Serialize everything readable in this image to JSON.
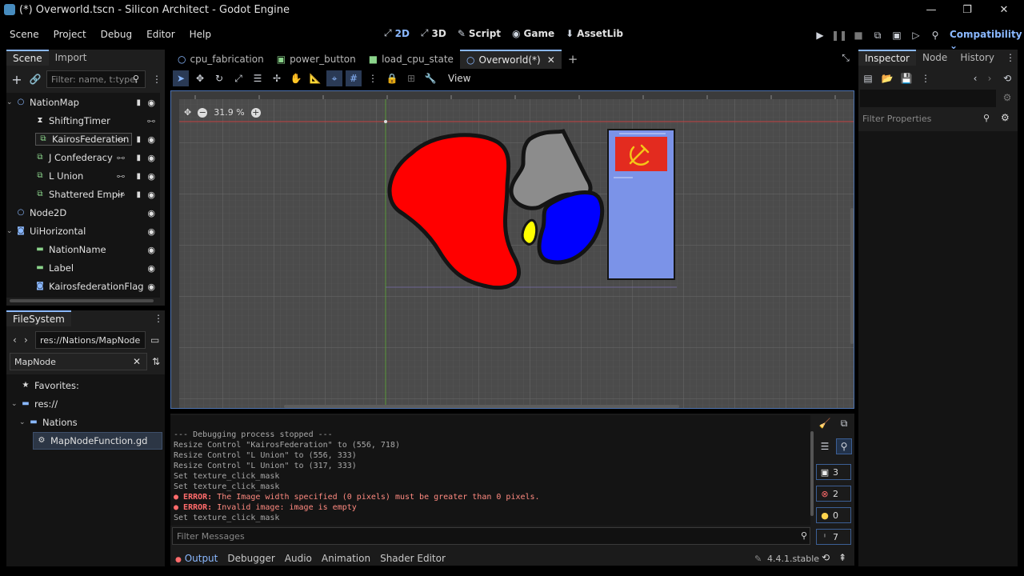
{
  "window": {
    "title": "(*) Overworld.tscn - Silicon Architect - Godot Engine"
  },
  "menu": [
    "Scene",
    "Project",
    "Debug",
    "Editor",
    "Help"
  ],
  "workspaces": [
    {
      "icon": "2d-icon",
      "glyph": "⬈",
      "label": "2D",
      "active": true
    },
    {
      "icon": "3d-icon",
      "glyph": "⬈",
      "label": "3D"
    },
    {
      "icon": "script-icon",
      "glyph": "✎",
      "label": "Script"
    },
    {
      "icon": "game-icon",
      "glyph": "🎮",
      "label": "Game"
    },
    {
      "icon": "assetlib-icon",
      "glyph": "⬇",
      "label": "AssetLib"
    }
  ],
  "renderer": "Compatibility",
  "scene_dock": {
    "tabs": [
      "Scene",
      "Import"
    ],
    "filter_placeholder": "Filter: name, t:type, g:",
    "tree": [
      {
        "label": "NationMap",
        "indent": 0,
        "expanded": true
      },
      {
        "label": "ShiftingTimer",
        "indent": 1
      },
      {
        "label": "KairosFederation",
        "indent": 1,
        "selected": true
      },
      {
        "label": "J Confederacy",
        "indent": 1
      },
      {
        "label": "L Union",
        "indent": 1
      },
      {
        "label": "Shattered Empir",
        "indent": 1
      },
      {
        "label": "Node2D",
        "indent": 0
      },
      {
        "label": "UiHorizontal",
        "indent": 0,
        "expanded": true
      },
      {
        "label": "NationName",
        "indent": 1
      },
      {
        "label": "Label",
        "indent": 1
      },
      {
        "label": "KairosfederationFlag",
        "indent": 1
      }
    ]
  },
  "filesystem": {
    "tab": "FileSystem",
    "path": "res://Nations/MapNodeFun",
    "search": "MapNode",
    "favorites": "Favorites:",
    "items": [
      "res://",
      "Nations",
      "MapNodeFunction.gd"
    ]
  },
  "editor_tabs": [
    "cpu_fabrication",
    "power_button",
    "load_cpu_state",
    "Overworld(*)"
  ],
  "toolbar": {
    "view": "View"
  },
  "viewport": {
    "zoom": "31.9 %"
  },
  "output": {
    "lines": [
      {
        "text": "--- Debugging process stopped ---"
      },
      {
        "text": "Resize Control \"KairosFederation\" to (556, 718)"
      },
      {
        "text": "Resize Control \"L Union\" to (556, 333)"
      },
      {
        "text": "Resize Control \"L Union\" to (317, 333)"
      },
      {
        "text": "Set texture_click_mask"
      },
      {
        "text": "Set texture_click_mask"
      },
      {
        "err": "ERROR:",
        "text": " The Image width specified (0 pixels) must be greater than 0 pixels."
      },
      {
        "err": "ERROR:",
        "text": " Invalid image: image is empty"
      },
      {
        "text": "Set texture_click_mask"
      }
    ],
    "filter_placeholder": "Filter Messages",
    "counts": {
      "messages": "3",
      "errors": "2",
      "warnings": "0",
      "info": "7"
    }
  },
  "bottom_tabs": [
    "Output",
    "Debugger",
    "Audio",
    "Animation",
    "Shader Editor"
  ],
  "version": "4.4.1.stable",
  "inspector": {
    "tabs": [
      "Inspector",
      "Node",
      "History"
    ],
    "filter_placeholder": "Filter Properties"
  },
  "colors": {
    "accent": "#8ab8ff",
    "red_nation": "#ff0000",
    "blue_nation": "#0000ff",
    "gray_nation": "#8c8c8c",
    "yellow_nation": "#ffff00",
    "panel_blue": "#7b93e8"
  }
}
